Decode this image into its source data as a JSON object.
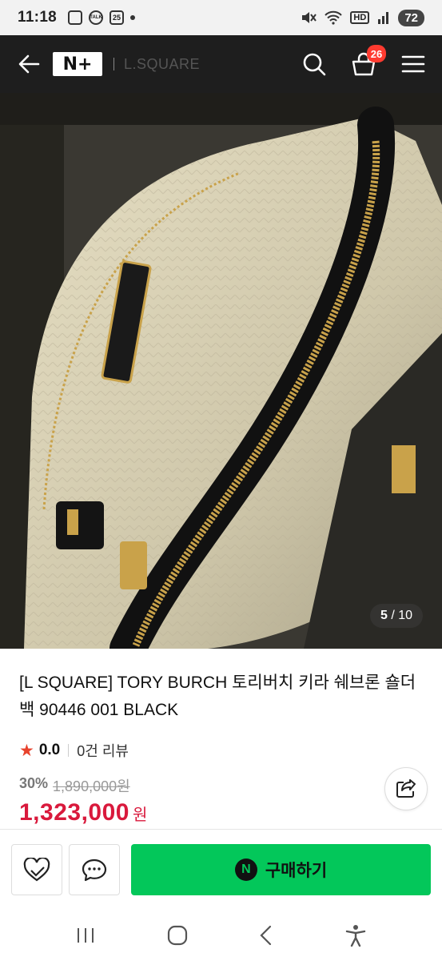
{
  "status_bar": {
    "time": "11:18",
    "badge_talk": "TALK",
    "badge_date": "25",
    "wifi_label": "HD",
    "battery": "72"
  },
  "topnav": {
    "naver_plus_logo": "N+",
    "brand_logo": "L.SQUARE",
    "cart_count": "26"
  },
  "product_image": {
    "current": "5",
    "total": "/ 10"
  },
  "product": {
    "title": "[L SQUARE] TORY BURCH 토리버치 키라 쉐브론 숄더백 90446 001 BLACK",
    "rating": "0.0",
    "review_count": "0건 리뷰",
    "discount": "30%",
    "original_price": "1,890,000원",
    "price": "1,323,000",
    "currency": "원"
  },
  "bottom_bar": {
    "buy_label": "구매하기",
    "buy_logo": "N"
  },
  "colors": {
    "nav_bg": "#1e1e1e",
    "buy_green": "#03c75a",
    "price_red": "#d9193c",
    "badge_red": "#ff3b30"
  }
}
